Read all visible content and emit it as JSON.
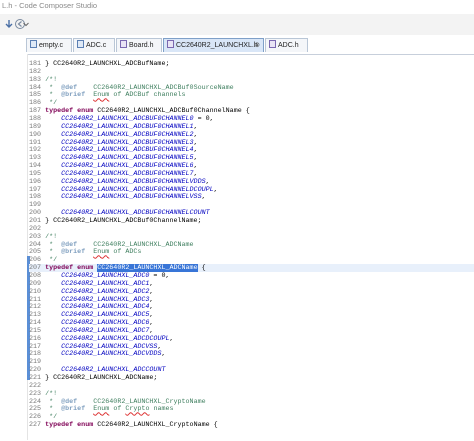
{
  "window": {
    "title": "L.h - Code Composer Studio"
  },
  "toolbar": {
    "icons": [
      "arrow-down-icon",
      "back-icon",
      "chevron-down-icon"
    ]
  },
  "tabs": [
    {
      "label": "empty.c",
      "active": false
    },
    {
      "label": "ADC.c",
      "active": false
    },
    {
      "label": "Board.h",
      "active": false
    },
    {
      "label": "CC2640R2_LAUNCHXL.h",
      "active": true,
      "close": "⊗"
    },
    {
      "label": "ADC.h",
      "active": false
    }
  ],
  "editor": {
    "lines": [
      {
        "n": "181",
        "tokens": [
          [
            "} CC2640R2_LAUNCHXL_ADCBufName;",
            "txt"
          ]
        ]
      },
      {
        "n": "182",
        "tokens": []
      },
      {
        "n": "183",
        "tokens": [
          [
            "/*!",
            "com"
          ]
        ]
      },
      {
        "n": "184",
        "tokens": [
          [
            " *  ",
            "com"
          ],
          [
            "@def",
            "tag"
          ],
          [
            "    CC2640R2_LAUNCHXL_ADCBuf0SourceName",
            "com"
          ]
        ]
      },
      {
        "n": "185",
        "tokens": [
          [
            " *  ",
            "com"
          ],
          [
            "@brief",
            "tag"
          ],
          [
            "  ",
            "com"
          ],
          [
            "Enum",
            "com-err"
          ],
          [
            " of ADCBuf channels",
            "com"
          ]
        ]
      },
      {
        "n": "186",
        "tokens": [
          [
            " */",
            "com"
          ]
        ]
      },
      {
        "n": "187",
        "tokens": [
          [
            "typedef enum",
            "kw"
          ],
          [
            " CC2640R2_LAUNCHXL_ADCBuf0ChannelName {",
            "txt"
          ]
        ]
      },
      {
        "n": "188",
        "tokens": [
          [
            "    ",
            "txt"
          ],
          [
            "CC2640R2_LAUNCHXL_ADCBUF0CHANNEL0",
            "en"
          ],
          [
            " = 0,",
            "txt"
          ]
        ]
      },
      {
        "n": "189",
        "tokens": [
          [
            "    ",
            "txt"
          ],
          [
            "CC2640R2_LAUNCHXL_ADCBUF0CHANNEL1",
            "en"
          ],
          [
            ",",
            "txt"
          ]
        ]
      },
      {
        "n": "190",
        "tokens": [
          [
            "    ",
            "txt"
          ],
          [
            "CC2640R2_LAUNCHXL_ADCBUF0CHANNEL2",
            "en"
          ],
          [
            ",",
            "txt"
          ]
        ]
      },
      {
        "n": "191",
        "tokens": [
          [
            "    ",
            "txt"
          ],
          [
            "CC2640R2_LAUNCHXL_ADCBUF0CHANNEL3",
            "en"
          ],
          [
            ",",
            "txt"
          ]
        ]
      },
      {
        "n": "192",
        "tokens": [
          [
            "    ",
            "txt"
          ],
          [
            "CC2640R2_LAUNCHXL_ADCBUF0CHANNEL4",
            "en"
          ],
          [
            ",",
            "txt"
          ]
        ]
      },
      {
        "n": "193",
        "tokens": [
          [
            "    ",
            "txt"
          ],
          [
            "CC2640R2_LAUNCHXL_ADCBUF0CHANNEL5",
            "en"
          ],
          [
            ",",
            "txt"
          ]
        ]
      },
      {
        "n": "194",
        "tokens": [
          [
            "    ",
            "txt"
          ],
          [
            "CC2640R2_LAUNCHXL_ADCBUF0CHANNEL6",
            "en"
          ],
          [
            ",",
            "txt"
          ]
        ]
      },
      {
        "n": "195",
        "tokens": [
          [
            "    ",
            "txt"
          ],
          [
            "CC2640R2_LAUNCHXL_ADCBUF0CHANNEL7",
            "en"
          ],
          [
            ",",
            "txt"
          ]
        ]
      },
      {
        "n": "196",
        "tokens": [
          [
            "    ",
            "txt"
          ],
          [
            "CC2640R2_LAUNCHXL_ADCBUF0CHANNELVDDS",
            "en"
          ],
          [
            ",",
            "txt"
          ]
        ]
      },
      {
        "n": "197",
        "tokens": [
          [
            "    ",
            "txt"
          ],
          [
            "CC2640R2_LAUNCHXL_ADCBUF0CHANNELDCOUPL",
            "en"
          ],
          [
            ",",
            "txt"
          ]
        ]
      },
      {
        "n": "198",
        "tokens": [
          [
            "    ",
            "txt"
          ],
          [
            "CC2640R2_LAUNCHXL_ADCBUF0CHANNELVSS",
            "en"
          ],
          [
            ",",
            "txt"
          ]
        ]
      },
      {
        "n": "199",
        "tokens": []
      },
      {
        "n": "200",
        "tokens": [
          [
            "    ",
            "txt"
          ],
          [
            "CC2640R2_LAUNCHXL_ADCBUF0CHANNELCOUNT",
            "en"
          ]
        ]
      },
      {
        "n": "201",
        "tokens": [
          [
            "} CC2640R2_LAUNCHXL_ADCBuf0ChannelName;",
            "txt"
          ]
        ]
      },
      {
        "n": "202",
        "tokens": []
      },
      {
        "n": "203",
        "tokens": [
          [
            "/*!",
            "com"
          ]
        ]
      },
      {
        "n": "204",
        "tokens": [
          [
            " *  ",
            "com"
          ],
          [
            "@def",
            "tag"
          ],
          [
            "    CC2640R2_LAUNCHXL_ADCName",
            "com"
          ]
        ]
      },
      {
        "n": "205",
        "tokens": [
          [
            " *  ",
            "com"
          ],
          [
            "@brief",
            "tag"
          ],
          [
            "  ",
            "com"
          ],
          [
            "Enum",
            "com-err"
          ],
          [
            " of ADCs",
            "com"
          ]
        ]
      },
      {
        "n": "206",
        "tokens": [
          [
            " */",
            "com"
          ]
        ]
      },
      {
        "n": "207",
        "cur": true,
        "tokens": [
          [
            "typedef enum",
            "kw"
          ],
          [
            " ",
            "txt"
          ],
          [
            "CC2640R2_LAUNCHXL_ADCName",
            "sel"
          ],
          [
            " {",
            "txt"
          ]
        ]
      },
      {
        "n": "208",
        "tokens": [
          [
            "    ",
            "txt"
          ],
          [
            "CC2640R2_LAUNCHXL_ADC0",
            "en"
          ],
          [
            " = 0,",
            "txt"
          ]
        ]
      },
      {
        "n": "209",
        "tokens": [
          [
            "    ",
            "txt"
          ],
          [
            "CC2640R2_LAUNCHXL_ADC1",
            "en"
          ],
          [
            ",",
            "txt"
          ]
        ]
      },
      {
        "n": "210",
        "tokens": [
          [
            "    ",
            "txt"
          ],
          [
            "CC2640R2_LAUNCHXL_ADC2",
            "en"
          ],
          [
            ",",
            "txt"
          ]
        ]
      },
      {
        "n": "211",
        "tokens": [
          [
            "    ",
            "txt"
          ],
          [
            "CC2640R2_LAUNCHXL_ADC3",
            "en"
          ],
          [
            ",",
            "txt"
          ]
        ]
      },
      {
        "n": "212",
        "tokens": [
          [
            "    ",
            "txt"
          ],
          [
            "CC2640R2_LAUNCHXL_ADC4",
            "en"
          ],
          [
            ",",
            "txt"
          ]
        ]
      },
      {
        "n": "213",
        "tokens": [
          [
            "    ",
            "txt"
          ],
          [
            "CC2640R2_LAUNCHXL_ADC5",
            "en"
          ],
          [
            ",",
            "txt"
          ]
        ]
      },
      {
        "n": "214",
        "tokens": [
          [
            "    ",
            "txt"
          ],
          [
            "CC2640R2_LAUNCHXL_ADC6",
            "en"
          ],
          [
            ",",
            "txt"
          ]
        ]
      },
      {
        "n": "215",
        "tokens": [
          [
            "    ",
            "txt"
          ],
          [
            "CC2640R2_LAUNCHXL_ADC7",
            "en"
          ],
          [
            ",",
            "txt"
          ]
        ]
      },
      {
        "n": "216",
        "tokens": [
          [
            "    ",
            "txt"
          ],
          [
            "CC2640R2_LAUNCHXL_ADCDCOUPL",
            "en"
          ],
          [
            ",",
            "txt"
          ]
        ]
      },
      {
        "n": "217",
        "tokens": [
          [
            "    ",
            "txt"
          ],
          [
            "CC2640R2_LAUNCHXL_ADCVSS",
            "en"
          ],
          [
            ",",
            "txt"
          ]
        ]
      },
      {
        "n": "218",
        "tokens": [
          [
            "    ",
            "txt"
          ],
          [
            "CC2640R2_LAUNCHXL_ADCVDDS",
            "en"
          ],
          [
            ",",
            "txt"
          ]
        ]
      },
      {
        "n": "219",
        "tokens": []
      },
      {
        "n": "220",
        "tokens": [
          [
            "    ",
            "txt"
          ],
          [
            "CC2640R2_LAUNCHXL_ADCCOUNT",
            "en"
          ]
        ]
      },
      {
        "n": "221",
        "tokens": [
          [
            "} CC2640R2_LAUNCHXL_ADCName;",
            "txt"
          ]
        ]
      },
      {
        "n": "222",
        "tokens": []
      },
      {
        "n": "223",
        "tokens": [
          [
            "/*!",
            "com"
          ]
        ]
      },
      {
        "n": "224",
        "tokens": [
          [
            " *  ",
            "com"
          ],
          [
            "@def",
            "tag"
          ],
          [
            "    CC2640R2_LAUNCHXL_CryptoName",
            "com"
          ]
        ]
      },
      {
        "n": "225",
        "tokens": [
          [
            " *  ",
            "com"
          ],
          [
            "@brief",
            "tag"
          ],
          [
            "  ",
            "com"
          ],
          [
            "Enum",
            "com-err"
          ],
          [
            " of ",
            "com"
          ],
          [
            "Crypto",
            "com-err"
          ],
          [
            " names",
            "com"
          ]
        ]
      },
      {
        "n": "226",
        "tokens": [
          [
            " */",
            "com"
          ]
        ]
      },
      {
        "n": "227",
        "tokens": [
          [
            "typedef enum",
            "kw"
          ],
          [
            " CC2640R2_LAUNCHXL_CryptoName {",
            "txt"
          ]
        ]
      }
    ]
  }
}
